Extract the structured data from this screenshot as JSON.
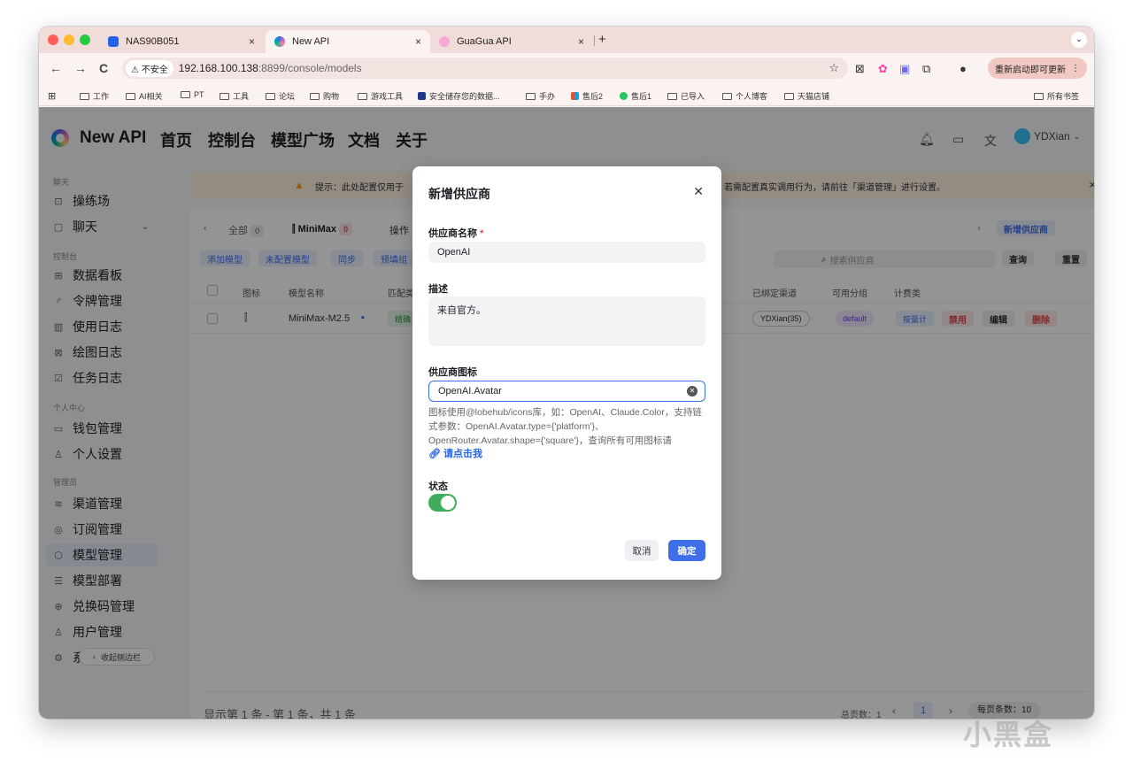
{
  "browser": {
    "tabs": [
      {
        "title": "NAS90B051",
        "close": "×"
      },
      {
        "title": "New API",
        "close": "×"
      },
      {
        "title": "GuaGua API",
        "close": "×"
      }
    ],
    "new_tab": "+",
    "menu": "⌄",
    "nav": {
      "back": "←",
      "forward": "→",
      "reload": "C"
    },
    "insecure_label": "不安全",
    "url_host": "192.168.100.138",
    "url_path": ":8899/console/models",
    "update_label": "重新启动即可更新",
    "bookmarks": [
      "工作",
      "AI相关",
      "PT",
      "工具",
      "论坛",
      "购物",
      "游戏工具",
      "安全储存您的数据...",
      "手办",
      "售后2",
      "售后1",
      "已导入",
      "个人博客",
      "天猫店铺"
    ],
    "all_bookmarks": "所有书签"
  },
  "header": {
    "brand": "New API",
    "nav": [
      "首页",
      "控制台",
      "模型广场",
      "文档",
      "关于"
    ],
    "user": "YDXian"
  },
  "sidebar": {
    "groups": [
      "聊天",
      "控制台",
      "个人中心",
      "管理员"
    ],
    "items": [
      {
        "label": "操练场",
        "icon": "playground-icon"
      },
      {
        "label": "聊天",
        "icon": "chat-icon"
      },
      {
        "label": "数据看板",
        "icon": "dashboard-icon"
      },
      {
        "label": "令牌管理",
        "icon": "key-icon"
      },
      {
        "label": "使用日志",
        "icon": "chart-icon"
      },
      {
        "label": "绘图日志",
        "icon": "image-icon"
      },
      {
        "label": "任务日志",
        "icon": "task-icon"
      },
      {
        "label": "钱包管理",
        "icon": "wallet-icon"
      },
      {
        "label": "个人设置",
        "icon": "user-icon"
      },
      {
        "label": "渠道管理",
        "icon": "layers-icon"
      },
      {
        "label": "订阅管理",
        "icon": "subscription-icon"
      },
      {
        "label": "模型管理",
        "icon": "model-icon"
      },
      {
        "label": "模型部署",
        "icon": "server-icon"
      },
      {
        "label": "兑换码管理",
        "icon": "gift-icon"
      },
      {
        "label": "用户管理",
        "icon": "users-icon"
      },
      {
        "label": "系统设置",
        "icon": "settings-icon"
      }
    ],
    "collapse": "收起侧边栏"
  },
  "content": {
    "banner_left": "提示：此处配置仅用于",
    "banner_right": "若需配置真实调用行为，请前往「渠道管理」进行设置。",
    "vendor_tabs": [
      {
        "label": "全部",
        "count": "0"
      },
      {
        "label": "MiniMax",
        "count": "0"
      },
      {
        "label": "操作"
      }
    ],
    "add_vendor": "新增供应商",
    "actions": [
      "添加模型",
      "未配置模型",
      "同步",
      "预填组"
    ],
    "search_placeholder": "搜索供应商",
    "query": "查询",
    "reset": "重置",
    "columns": [
      "图标",
      "模型名称",
      "匹配类",
      "已绑定渠道",
      "可用分组",
      "计费类"
    ],
    "row": {
      "name": "MiniMax-M2.5",
      "match": "精确",
      "channel": "YDXian(35)",
      "group": "default",
      "billing": "按量计",
      "disable": "禁用",
      "edit": "编辑",
      "delete": "删除"
    },
    "footer": "显示第 1 条 - 第 1 条，共 1 条",
    "total_pages": "总页数：1",
    "page": "1",
    "per_page": "每页条数：10"
  },
  "modal": {
    "title": "新增供应商",
    "name_label": "供应商名称",
    "required_mark": "*",
    "name_value": "OpenAI",
    "desc_label": "描述",
    "desc_value": "来自官方。",
    "icon_label": "供应商图标",
    "icon_value": "OpenAI.Avatar",
    "help_text": "图标使用@lobehub/icons库，如：OpenAI、Claude.Color，支持链式参数：OpenAI.Avatar.type={'platform'}、OpenRouter.Avatar.shape={'square'}，查询所有可用图标请",
    "help_link": "请点击我",
    "status_label": "状态",
    "status_on": true,
    "cancel": "取消",
    "confirm": "确定"
  },
  "watermark": "小黑盒",
  "colors": {
    "primary": "#3f6fe8",
    "toggle_on": "#3fae5b",
    "danger": "#e5484d",
    "tabstrip": "#f0dcd8"
  }
}
